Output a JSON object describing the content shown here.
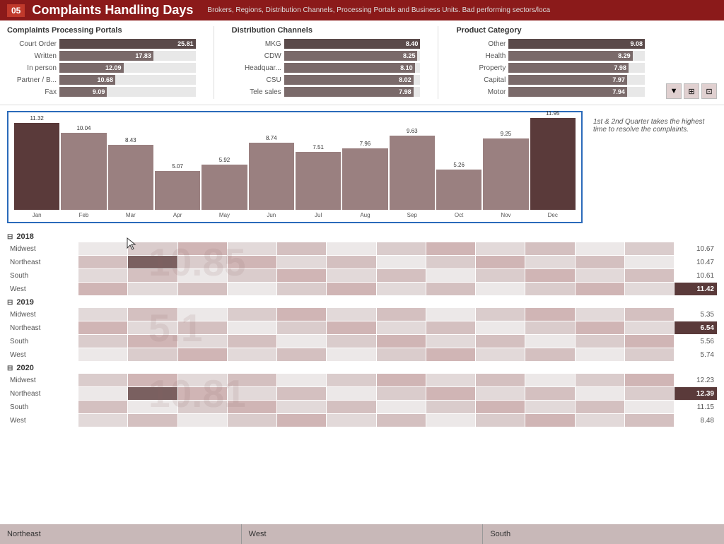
{
  "header": {
    "badge": "05",
    "title": "Complaints Handling Days",
    "subtitle": "Brokers, Regions, Distribution Channels, Processing Portals and Business Units. Bad performing sectors/loca"
  },
  "processing_portals": {
    "title": "Complaints Processing Portals",
    "bars": [
      {
        "label": "Court Order",
        "value": 25.81,
        "pct": 100
      },
      {
        "label": "Written",
        "value": 17.83,
        "pct": 69
      },
      {
        "label": "In person",
        "value": 12.09,
        "pct": 47
      },
      {
        "label": "Partner / B...",
        "value": 10.68,
        "pct": 41
      },
      {
        "label": "Fax",
        "value": 9.09,
        "pct": 35
      }
    ]
  },
  "distribution_channels": {
    "title": "Distribution Channels",
    "bars": [
      {
        "label": "MKG",
        "value": 8.4,
        "pct": 100
      },
      {
        "label": "CDW",
        "value": 8.25,
        "pct": 98
      },
      {
        "label": "Headquar...",
        "value": 8.1,
        "pct": 96
      },
      {
        "label": "CSU",
        "value": 8.02,
        "pct": 95
      },
      {
        "label": "Tele sales",
        "value": 7.98,
        "pct": 95
      }
    ]
  },
  "product_category": {
    "title": "Product Category",
    "bars": [
      {
        "label": "Other",
        "value": 9.08,
        "pct": 100
      },
      {
        "label": "Health",
        "value": 8.29,
        "pct": 91
      },
      {
        "label": "Property",
        "value": 7.98,
        "pct": 88
      },
      {
        "label": "Capital",
        "value": 7.97,
        "pct": 87
      },
      {
        "label": "Motor",
        "value": 7.94,
        "pct": 87
      }
    ]
  },
  "bar_chart": {
    "months": [
      "Jan",
      "Feb",
      "Mar",
      "Apr",
      "May",
      "Jun",
      "Jul",
      "Aug",
      "Sep",
      "Oct",
      "Nov",
      "Dec"
    ],
    "values": [
      11.32,
      10.04,
      8.43,
      5.07,
      5.92,
      8.74,
      7.51,
      7.96,
      9.63,
      5.26,
      9.25,
      11.95
    ],
    "note": "1st & 2nd Quarter takes the highest time to resolve the complaints."
  },
  "heatmap": {
    "years": [
      {
        "year": "2018",
        "regions": [
          "Midwest",
          "Northeast",
          "South",
          "West"
        ],
        "watermark": "10.85",
        "row_values": [
          "10.67",
          "10.47",
          "10.61",
          "11.42"
        ],
        "highlight_row": 3
      },
      {
        "year": "2019",
        "regions": [
          "Midwest",
          "Northeast",
          "South",
          "West"
        ],
        "watermark": "5.1",
        "row_values": [
          "5.35",
          "6.54",
          "5.56",
          "5.74"
        ],
        "highlight_row": 1
      },
      {
        "year": "2020",
        "regions": [
          "Midwest",
          "Northeast",
          "South",
          "West"
        ],
        "watermark": "10.81",
        "row_values": [
          "12.23",
          "12.39",
          "11.15",
          "8.48"
        ],
        "highlight_row": 1
      }
    ]
  },
  "footer_tabs": [
    {
      "label": "Northeast"
    },
    {
      "label": "West"
    },
    {
      "label": "South"
    }
  ],
  "filter_icons": [
    "▼",
    "⊞"
  ]
}
